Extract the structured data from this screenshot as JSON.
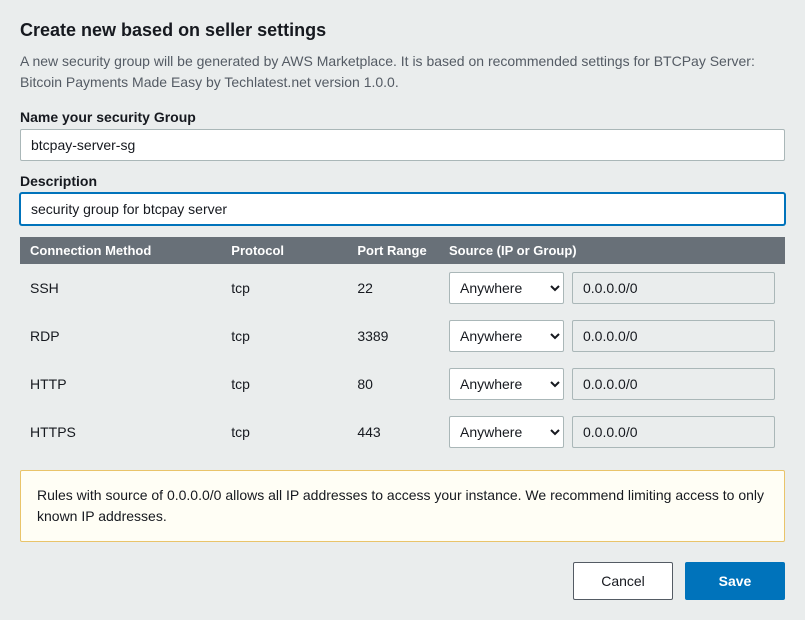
{
  "heading": "Create new based on seller settings",
  "subtext": "A new security group will be generated by AWS Marketplace. It is based on recommended settings for BTCPay Server: Bitcoin Payments Made Easy by Techlatest.net version 1.0.0.",
  "nameField": {
    "label": "Name your security Group",
    "value": "btcpay-server-sg"
  },
  "descriptionField": {
    "label": "Description",
    "value": "security group for btcpay server"
  },
  "table": {
    "headers": {
      "connection": "Connection Method",
      "protocol": "Protocol",
      "portRange": "Port Range",
      "source": "Source (IP or Group)"
    },
    "sourceOption": "Anywhere",
    "rows": [
      {
        "connection": "SSH",
        "protocol": "tcp",
        "port": "22",
        "sourceSel": "Anywhere",
        "sourceVal": "0.0.0.0/0"
      },
      {
        "connection": "RDP",
        "protocol": "tcp",
        "port": "3389",
        "sourceSel": "Anywhere",
        "sourceVal": "0.0.0.0/0"
      },
      {
        "connection": "HTTP",
        "protocol": "tcp",
        "port": "80",
        "sourceSel": "Anywhere",
        "sourceVal": "0.0.0.0/0"
      },
      {
        "connection": "HTTPS",
        "protocol": "tcp",
        "port": "443",
        "sourceSel": "Anywhere",
        "sourceVal": "0.0.0.0/0"
      }
    ]
  },
  "warning": "Rules with source of 0.0.0.0/0 allows all IP addresses to access your instance. We recommend limiting access to only known IP addresses.",
  "buttons": {
    "cancel": "Cancel",
    "save": "Save"
  }
}
